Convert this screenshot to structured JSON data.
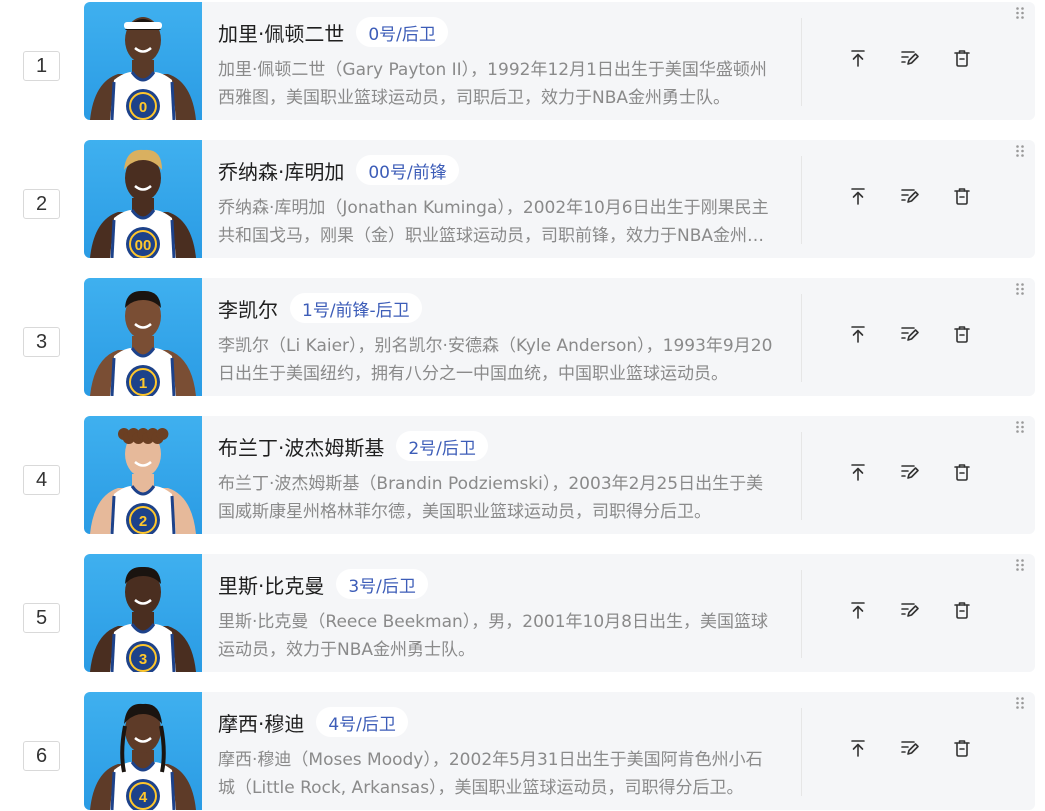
{
  "rows": [
    {
      "index": "1",
      "name": "加里·佩顿二世",
      "tag": "0号/后卫",
      "desc": "加里·佩顿二世（Gary Payton II），1992年12月1日出生于美国华盛顿州西雅图，美国职业篮球运动员，司职后卫，效力于NBA金州勇士队。",
      "jersey": "0",
      "hair": "headband"
    },
    {
      "index": "2",
      "name": "乔纳森·库明加",
      "tag": "00号/前锋",
      "desc": "乔纳森·库明加（Jonathan Kuminga），2002年10月6日出生于刚果民主共和国戈马，刚果（金）职业篮球运动员，司职前锋，效力于NBA金州勇士队。",
      "jersey": "00",
      "hair": "blond"
    },
    {
      "index": "3",
      "name": "李凯尔",
      "tag": "1号/前锋-后卫",
      "desc": "李凯尔（Li Kaier），别名凯尔·安德森（Kyle Anderson），1993年9月20日出生于美国纽约，拥有八分之一中国血统，中国职业篮球运动员。",
      "jersey": "1",
      "hair": "short"
    },
    {
      "index": "4",
      "name": "布兰丁·波杰姆斯基",
      "tag": "2号/后卫",
      "desc": "布兰丁·波杰姆斯基（Brandin Podziemski），2003年2月25日出生于美国威斯康星州格林菲尔德，美国职业篮球运动员，司职得分后卫。",
      "jersey": "2",
      "hair": "curly"
    },
    {
      "index": "5",
      "name": "里斯·比克曼",
      "tag": "3号/后卫",
      "desc": "里斯·比克曼（Reece Beekman），男，2001年10月8日出生，美国篮球运动员，效力于NBA金州勇士队。",
      "jersey": "3",
      "hair": "dark"
    },
    {
      "index": "6",
      "name": "摩西·穆迪",
      "tag": "4号/后卫",
      "desc": "摩西·穆迪（Moses Moody），2002年5月31日出生于美国阿肯色州小石城（Little Rock, Arkansas），美国职业篮球运动员，司职得分后卫。",
      "jersey": "4",
      "hair": "braids"
    }
  ],
  "actions": [
    {
      "icon": "move-to-top-icon"
    },
    {
      "icon": "edit-icon"
    },
    {
      "icon": "delete-icon"
    }
  ],
  "colors": {
    "card_bg": "#f5f6f8",
    "tag_text": "#3d5db8",
    "photo_bg": "#3fb0ef",
    "jersey_blue": "#1d428a",
    "jersey_gold": "#ffc72c"
  }
}
